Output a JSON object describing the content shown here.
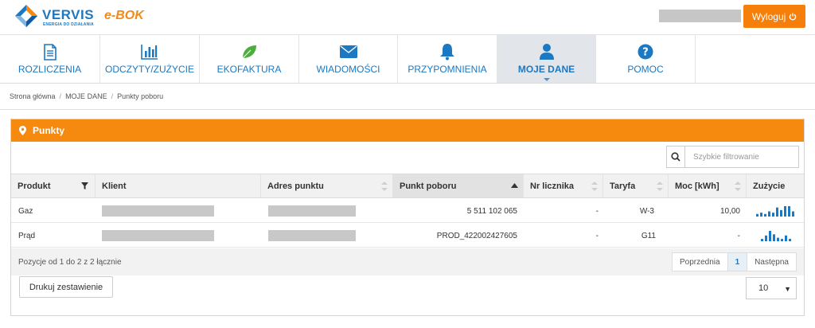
{
  "header": {
    "brand": "VERVIS",
    "brand_tagline": "ENERGIA DO DZIAŁANIA",
    "product": "e-BOK",
    "logout_label": "Wyloguj",
    "colors": {
      "primary": "#1b78c2",
      "accent": "#f67e0b"
    }
  },
  "nav": [
    {
      "label": "ROZLICZENIA",
      "icon": "document-icon"
    },
    {
      "label": "ODCZYTY/ZUŻYCIE",
      "icon": "bar-chart-icon"
    },
    {
      "label": "EKOFAKTURA",
      "icon": "leaf-icon"
    },
    {
      "label": "WIADOMOŚCI",
      "icon": "envelope-icon"
    },
    {
      "label": "PRZYPOMNIENIA",
      "icon": "bell-icon"
    },
    {
      "label": "MOJE DANE",
      "icon": "user-icon",
      "active": true
    },
    {
      "label": "POMOC",
      "icon": "question-icon"
    }
  ],
  "breadcrumb": [
    "Strona główna",
    "MOJE DANE",
    "Punkty poboru"
  ],
  "panel": {
    "title": "Punkty",
    "search_placeholder": "Szybkie filtrowanie",
    "columns": [
      "Produkt",
      "Klient",
      "Adres punktu",
      "Punkt poboru",
      "Nr licznika",
      "Taryfa",
      "Moc [kWh]",
      "Zużycie"
    ],
    "rows": [
      {
        "produkt": "Gaz",
        "punkt_poboru": "5 511 102 065",
        "nr_licznika": "-",
        "taryfa": "W-3",
        "moc": "10,00",
        "zuzycie": [
          2,
          3,
          2,
          4,
          3,
          7,
          5,
          8,
          8,
          4
        ]
      },
      {
        "produkt": "Prąd",
        "punkt_poboru": "PROD_422002427605",
        "nr_licznika": "-",
        "taryfa": "G11",
        "moc": "-",
        "zuzycie": [
          2,
          5,
          9,
          6,
          3,
          2,
          5,
          2
        ]
      }
    ],
    "position_text": "Pozycje od 1 do 2 z 2 łącznie",
    "pager": {
      "prev": "Poprzednia",
      "current": "1",
      "next": "Następna"
    },
    "print_label": "Drukuj zestawienie",
    "page_size": "10"
  }
}
